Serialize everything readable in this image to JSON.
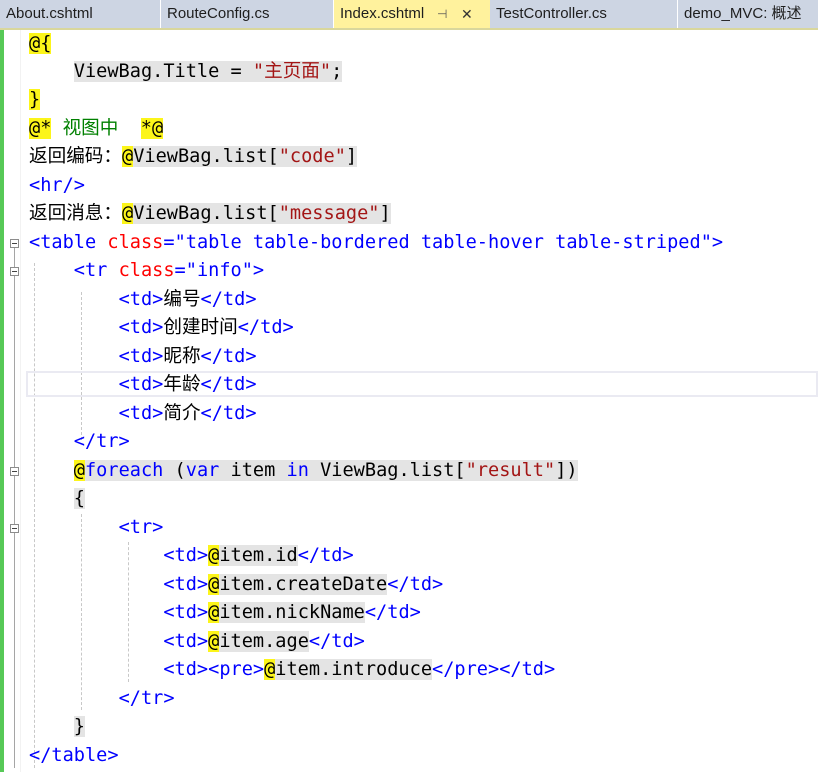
{
  "tabs": [
    {
      "label": "About.cshtml"
    },
    {
      "label": "RouteConfig.cs"
    },
    {
      "label": "Index.cshtml",
      "pin": "⊣",
      "close": "✕"
    },
    {
      "label": "TestController.cs"
    },
    {
      "label": "demo_MVC: 概述"
    }
  ],
  "code": {
    "l1": {
      "a": "@{"
    },
    "l2": {
      "a": "ViewBag.Title = ",
      "b": "\"主页面\"",
      "c": ";"
    },
    "l3": {
      "a": "}"
    },
    "l4": {
      "a": "@*",
      "b": " 视图中  ",
      "c": "*@"
    },
    "l5": {
      "a": "返回编码：",
      "b": "@",
      "c": "ViewBag.list[",
      "d": "\"code\"",
      "e": "]"
    },
    "l6": {
      "a": "<hr/>"
    },
    "l7": {
      "a": "返回消息：",
      "b": "@",
      "c": "ViewBag.list[",
      "d": "\"message\"",
      "e": "]"
    },
    "l8": {
      "a": "<table ",
      "b": "class",
      "c": "=",
      "d": "\"table table-bordered table-hover table-striped\"",
      "e": ">"
    },
    "l9": {
      "a": "<tr ",
      "b": "class",
      "c": "=",
      "d": "\"info\"",
      "e": ">"
    },
    "l10": {
      "a": "<td>",
      "b": "编号",
      "c": "</td>"
    },
    "l11": {
      "a": "<td>",
      "b": "创建时间",
      "c": "</td>"
    },
    "l12": {
      "a": "<td>",
      "b": "昵称",
      "c": "</td>"
    },
    "l13": {
      "a": "<td>",
      "b": "年龄",
      "c": "</td>"
    },
    "l14": {
      "a": "<td>",
      "b": "简介",
      "c": "</td>"
    },
    "l15": {
      "a": "</tr>"
    },
    "l16": {
      "a": "@",
      "b": "foreach",
      "c": " (",
      "d": "var",
      "e": " item ",
      "f": "in",
      "g": " ViewBag.list[",
      "h": "\"result\"",
      "i": "])"
    },
    "l17": {
      "a": "{"
    },
    "l18": {
      "a": "<tr>"
    },
    "l19": {
      "a": "<td>",
      "b": "@",
      "c": "item.id",
      "d": "</td>"
    },
    "l20": {
      "a": "<td>",
      "b": "@",
      "c": "item.createDate",
      "d": "</td>"
    },
    "l21": {
      "a": "<td>",
      "b": "@",
      "c": "item.nickName",
      "d": "</td>"
    },
    "l22": {
      "a": "<td>",
      "b": "@",
      "c": "item.age",
      "d": "</td>"
    },
    "l23": {
      "a": "<td><pre>",
      "b": "@",
      "c": "item.introduce",
      "d": "</pre></td>"
    },
    "l24": {
      "a": "</tr>"
    },
    "l25": {
      "a": "}"
    },
    "l26": {
      "a": "</table>"
    }
  }
}
